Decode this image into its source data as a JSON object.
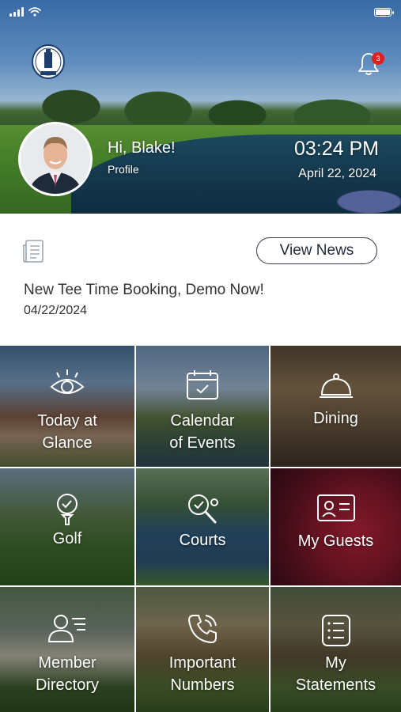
{
  "status_bar": {
    "battery_level": 1.0
  },
  "header": {
    "greeting": "Hi, Blake!",
    "profile_label": "Profile",
    "time": "03:24 PM",
    "date": "April 22, 2024",
    "notification_count": "3",
    "logo_text": "THE VILLAGES"
  },
  "news": {
    "button_label": "View News",
    "headline": "New Tee Time Booking, Demo Now!",
    "date": "04/22/2024"
  },
  "tiles": [
    {
      "line1": "Today at",
      "line2": "Glance",
      "icon": "eye-icon"
    },
    {
      "line1": "Calendar",
      "line2": "of Events",
      "icon": "calendar-icon"
    },
    {
      "line1": "Dining",
      "line2": "",
      "icon": "cloche-icon"
    },
    {
      "line1": "Golf",
      "line2": "",
      "icon": "golf-ball-icon"
    },
    {
      "line1": "Courts",
      "line2": "",
      "icon": "tennis-racket-icon"
    },
    {
      "line1": "My Guests",
      "line2": "",
      "icon": "id-card-icon"
    },
    {
      "line1": "Member",
      "line2": "Directory",
      "icon": "directory-icon"
    },
    {
      "line1": "Important",
      "line2": "Numbers",
      "icon": "phone-icon"
    },
    {
      "line1": "My",
      "line2": "Statements",
      "icon": "statement-icon"
    }
  ],
  "colors": {
    "badge": "#e02020",
    "button_border": "#2f3b47",
    "text_dark": "#333333"
  }
}
